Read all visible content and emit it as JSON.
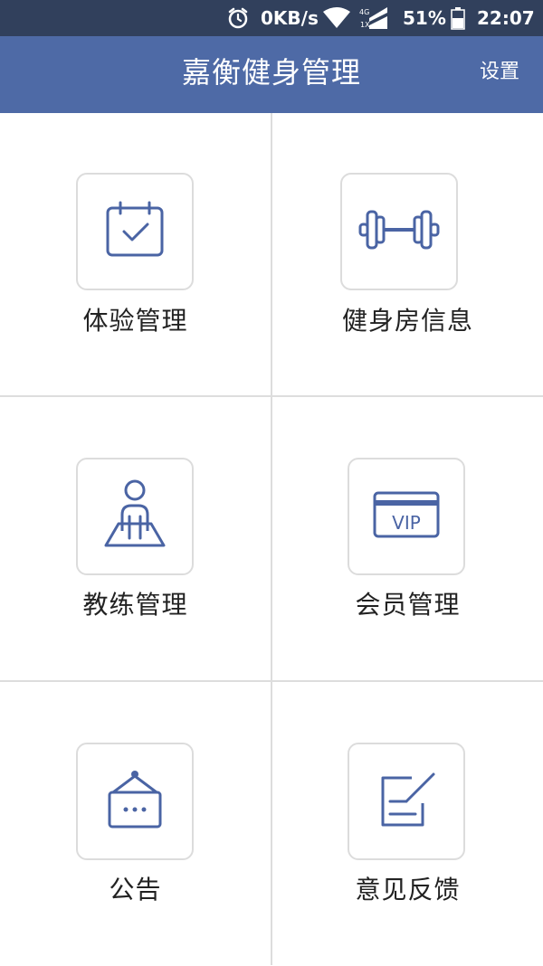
{
  "status_bar": {
    "speed": "0KB/s",
    "network_badge_top": "4G",
    "network_badge_bottom": "1X",
    "battery_percent": "51%",
    "time": "22:07"
  },
  "header": {
    "title": "嘉衡健身管理",
    "settings_label": "设置"
  },
  "menu": {
    "items": [
      {
        "label": "体验管理",
        "icon": "calendar-check-icon"
      },
      {
        "label": "健身房信息",
        "icon": "dumbbell-icon"
      },
      {
        "label": "教练管理",
        "icon": "coach-person-icon"
      },
      {
        "label": "会员管理",
        "icon": "vip-card-icon"
      },
      {
        "label": "公告",
        "icon": "notice-board-icon"
      },
      {
        "label": "意见反馈",
        "icon": "feedback-edit-icon"
      }
    ],
    "vip_text": "VIP"
  },
  "colors": {
    "header_bg": "#4e6aa6",
    "status_bg": "#31405c",
    "icon_blue": "#4a64a4"
  }
}
